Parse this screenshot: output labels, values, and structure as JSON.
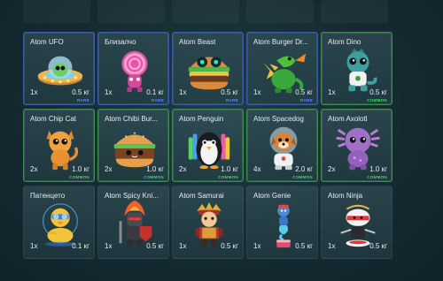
{
  "colors": {
    "rare_border": "#3b5ea8",
    "common_border": "#3f8a52",
    "rare_label": "#5d8cff",
    "common_label": "#4fd36a"
  },
  "items": [
    {
      "name": "Atom UFO",
      "qty": "1x",
      "weight": "0.5 кг",
      "rarity": "RARE",
      "icon": "ufo-icon"
    },
    {
      "name": "Близалчо",
      "qty": "1x",
      "weight": "0.1 кг",
      "rarity": "RARE",
      "icon": "lollipop-creature-icon"
    },
    {
      "name": "Atom Beast",
      "qty": "1x",
      "weight": "0.5 кг",
      "rarity": "RARE",
      "icon": "burger-beast-icon"
    },
    {
      "name": "Atom Burger Dr...",
      "qty": "1x",
      "weight": "0.5 кг",
      "rarity": "RARE",
      "icon": "burger-dragon-icon"
    },
    {
      "name": "Atom Dino",
      "qty": "1x",
      "weight": "0.5 кг",
      "rarity": "COMMON",
      "icon": "dino-icon"
    },
    {
      "name": "Atom Chip Cat",
      "qty": "2x",
      "weight": "1.0 кг",
      "rarity": "COMMON",
      "icon": "chip-cat-icon"
    },
    {
      "name": "Atom Chibi Bur...",
      "qty": "2x",
      "weight": "1.0 кг",
      "rarity": "COMMON",
      "icon": "chibi-burger-icon"
    },
    {
      "name": "Atom Penguin",
      "qty": "2x",
      "weight": "1.0 кг",
      "rarity": "COMMON",
      "icon": "penguin-icon"
    },
    {
      "name": "Atom Spacedog",
      "qty": "4x",
      "weight": "2.0 кг",
      "rarity": "COMMON",
      "icon": "spacedog-icon"
    },
    {
      "name": "Atom Axolotl",
      "qty": "2x",
      "weight": "1.0 кг",
      "rarity": "COMMON",
      "icon": "axolotl-icon"
    },
    {
      "name": "Патенцето",
      "qty": "1x",
      "weight": "0.1 кг",
      "rarity": "",
      "icon": "duckling-icon"
    },
    {
      "name": "Atom Spicy Kni...",
      "qty": "1x",
      "weight": "0.5 кг",
      "rarity": "",
      "icon": "spicy-knight-icon"
    },
    {
      "name": "Atom Samurai",
      "qty": "1x",
      "weight": "0.5 кг",
      "rarity": "",
      "icon": "samurai-icon"
    },
    {
      "name": "Atom Genie",
      "qty": "1x",
      "weight": "0.5 кг",
      "rarity": "",
      "icon": "genie-icon"
    },
    {
      "name": "Atom Ninja",
      "qty": "1x",
      "weight": "0.5 кг",
      "rarity": "",
      "icon": "ninja-icon"
    }
  ]
}
